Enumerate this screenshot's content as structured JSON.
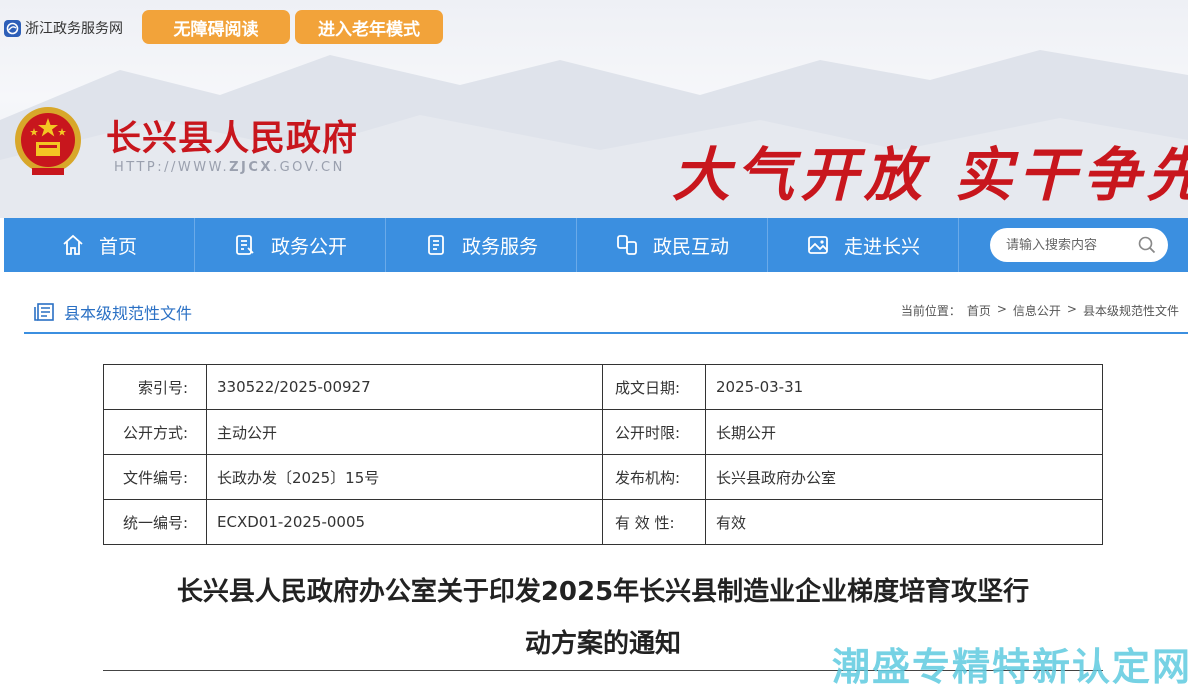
{
  "topbar": {
    "zj_link": "浙江政务服务网",
    "accessible_btn": "无障碍阅读",
    "elder_btn": "进入老年模式"
  },
  "site": {
    "name": "长兴县人民政府",
    "url_prefix": "HTTP://WWW.",
    "url_bold": "ZJCX",
    "url_suffix": ".GOV.CN",
    "slogan": "大气开放 实干争先"
  },
  "nav": {
    "items": [
      {
        "label": "首页",
        "icon": "home-icon"
      },
      {
        "label": "政务公开",
        "icon": "document-icon"
      },
      {
        "label": "政务服务",
        "icon": "file-list-icon"
      },
      {
        "label": "政民互动",
        "icon": "interaction-icon"
      },
      {
        "label": "走进长兴",
        "icon": "picture-icon"
      }
    ],
    "search_placeholder": "请输入搜索内容"
  },
  "section": {
    "title": "县本级规范性文件",
    "breadcrumb_label": "当前位置：",
    "crumbs": [
      "首页",
      "信息公开",
      "县本级规范性文件"
    ],
    "sep": ">"
  },
  "meta": {
    "rows": [
      {
        "k1": "索引号:",
        "v1": "330522/2025-00927",
        "k2": "成文日期:",
        "v2": "2025-03-31"
      },
      {
        "k1": "公开方式:",
        "v1": "主动公开",
        "k2": "公开时限:",
        "v2": "长期公开"
      },
      {
        "k1": "文件编号:",
        "v1": "长政办发〔2025〕15号",
        "k2": "发布机构:",
        "v2": "长兴县政府办公室"
      },
      {
        "k1": "统一编号:",
        "v1": "ECXD01-2025-0005",
        "k2": "有 效 性:",
        "v2": "有效"
      }
    ]
  },
  "document": {
    "title_line1": "长兴县人民政府办公室关于印发2025年长兴县制造业企业梯度培育攻坚行",
    "title_line2": "动方案的通知"
  },
  "watermark": "潮盛专精特新认定网",
  "colors": {
    "nav_blue": "#3b8fe0",
    "brand_red": "#c8161d",
    "pill_orange": "#f2a33a"
  }
}
